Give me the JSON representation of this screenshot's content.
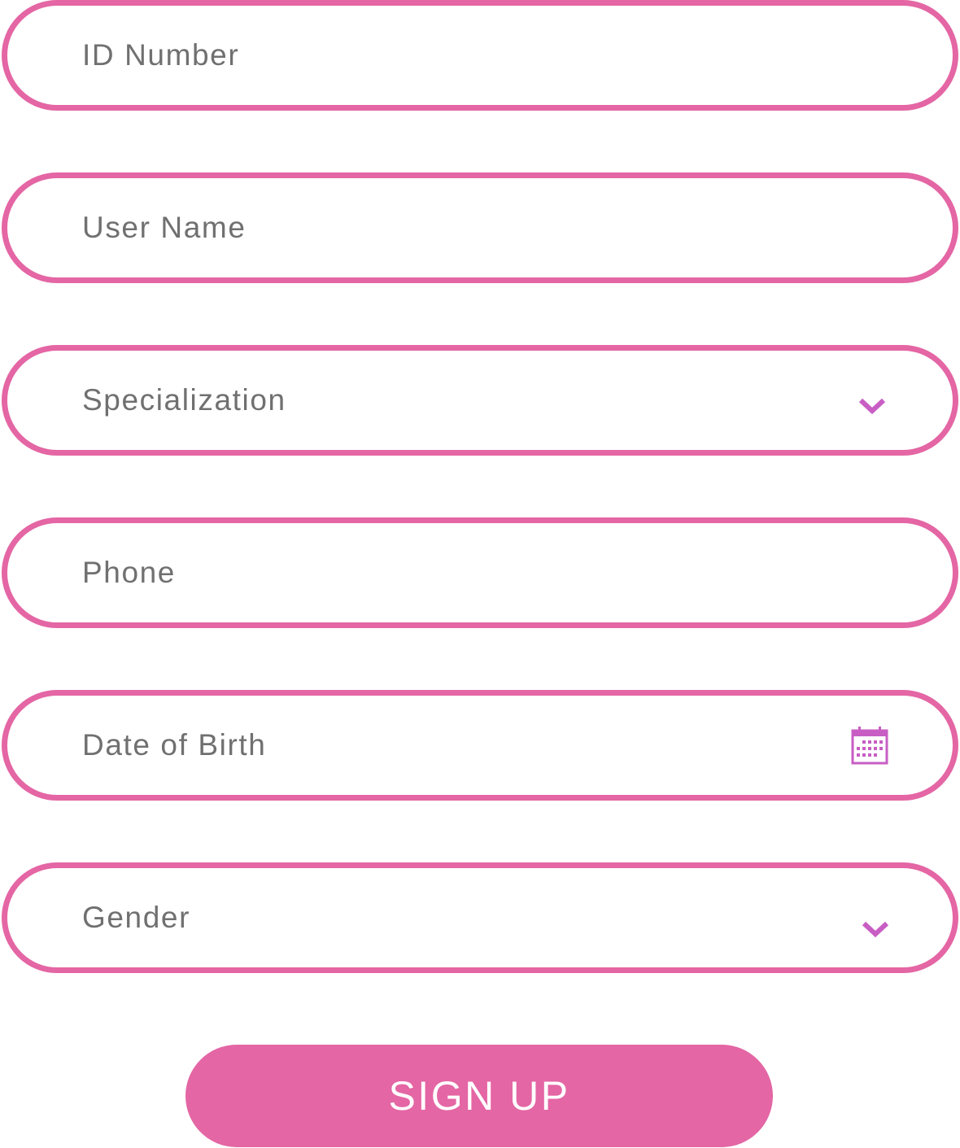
{
  "form": {
    "id_number": {
      "placeholder": "ID Number",
      "value": ""
    },
    "user_name": {
      "placeholder": "User Name",
      "value": ""
    },
    "specialization": {
      "label": "Specialization"
    },
    "phone": {
      "placeholder": "Phone",
      "value": ""
    },
    "date_of_birth": {
      "placeholder": "Date of Birth",
      "value": ""
    },
    "gender": {
      "label": "Gender"
    },
    "submit_label": "SIGN UP"
  },
  "icons": {
    "dropdown": "chevron-down-icon",
    "date": "calendar-icon"
  },
  "colors": {
    "accent": "#e466a4",
    "icon": "#c85ec4",
    "placeholder_text": "#707070",
    "button_text": "#ffffff",
    "background": "#ffffff"
  }
}
